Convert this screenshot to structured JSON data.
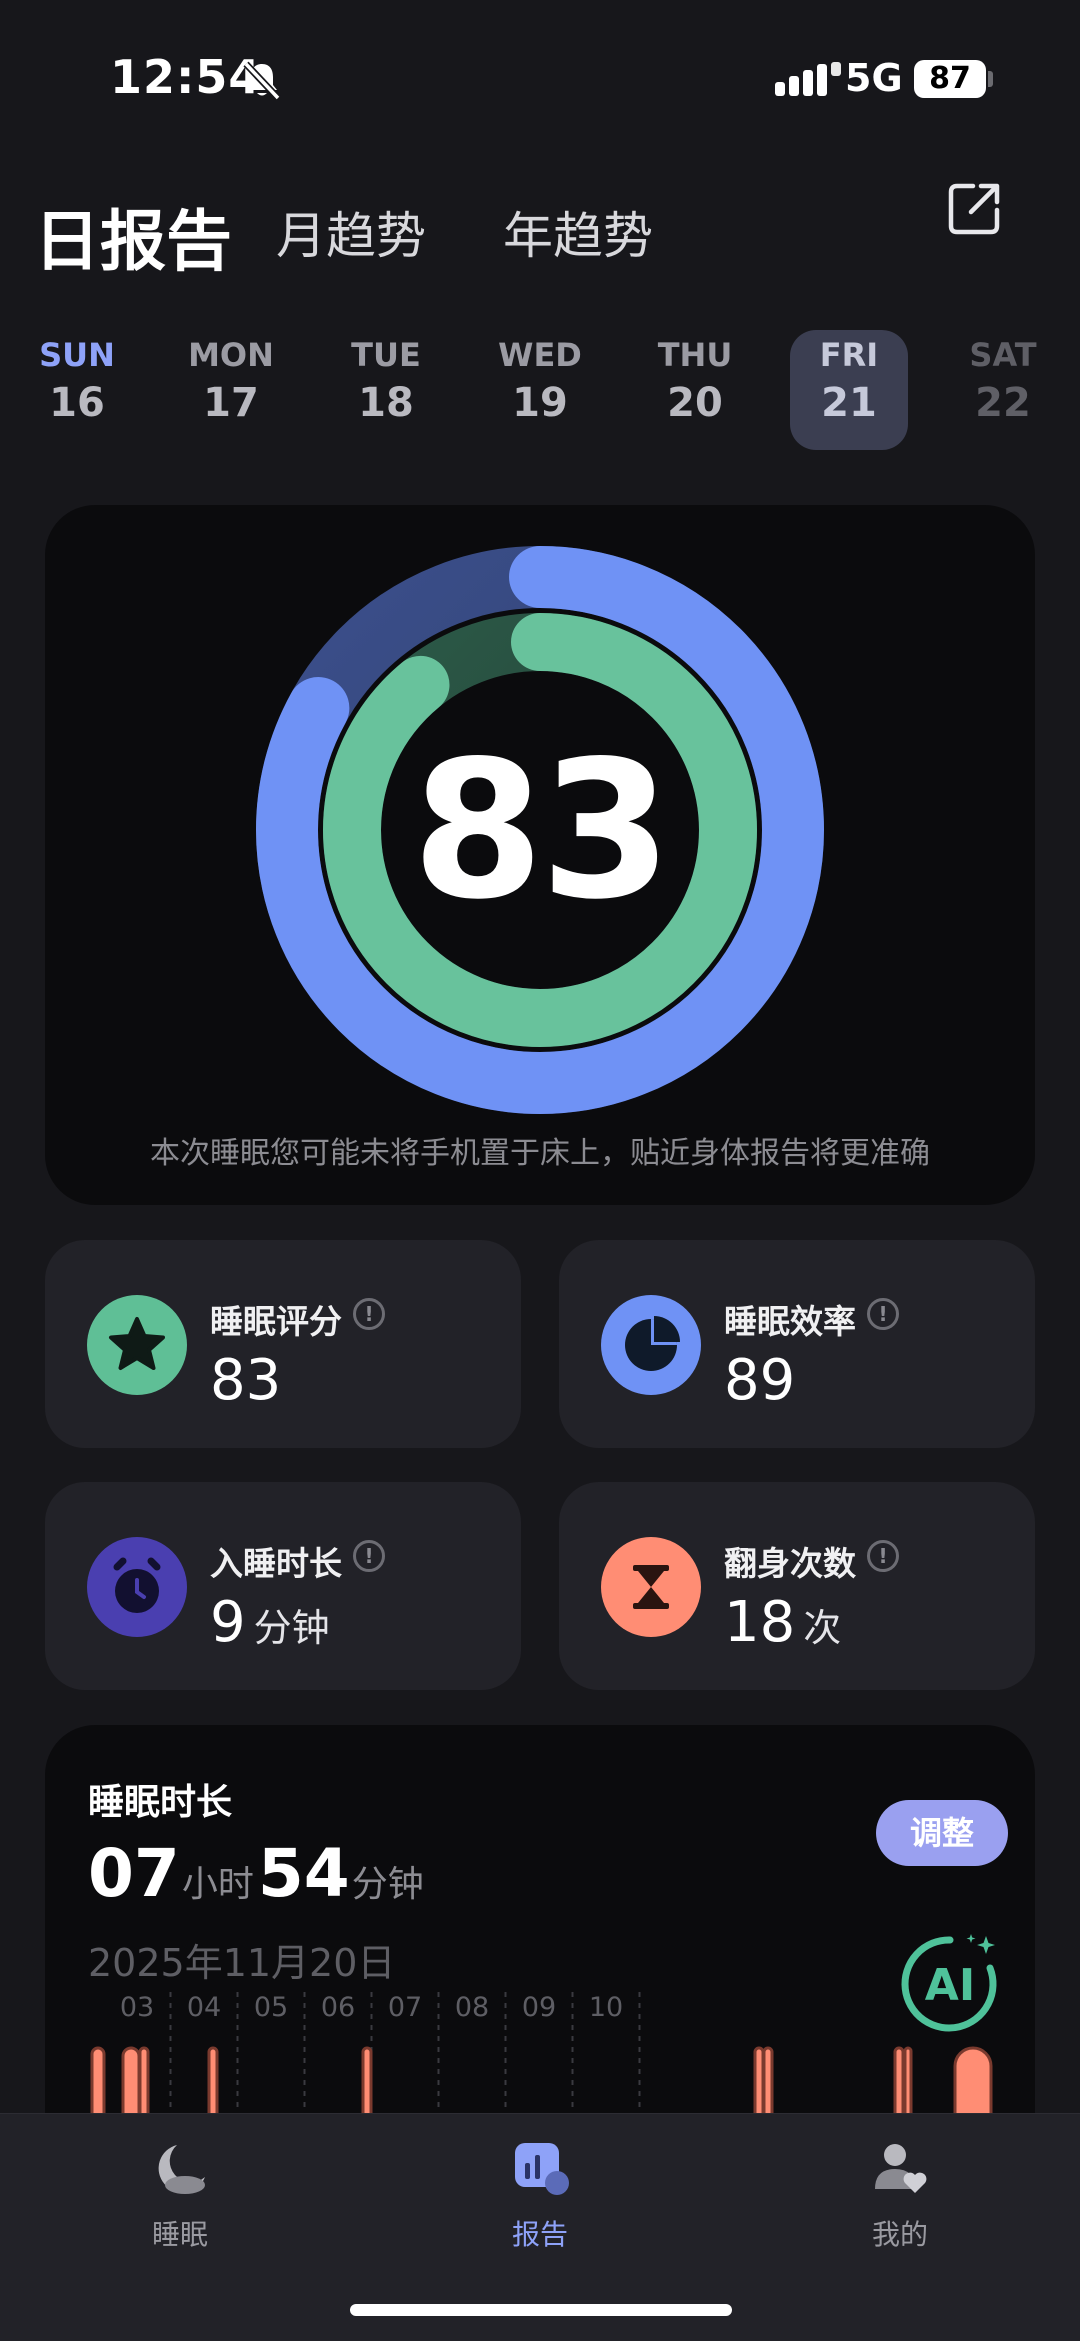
{
  "status": {
    "time": "12:54",
    "network": "5G",
    "battery": "87"
  },
  "header": {
    "tabs": [
      "日报告",
      "月趋势",
      "年趋势"
    ]
  },
  "week": [
    {
      "wd": "SUN",
      "dn": "16"
    },
    {
      "wd": "MON",
      "dn": "17"
    },
    {
      "wd": "TUE",
      "dn": "18"
    },
    {
      "wd": "WED",
      "dn": "19"
    },
    {
      "wd": "THU",
      "dn": "20"
    },
    {
      "wd": "FRI",
      "dn": "21"
    },
    {
      "wd": "SAT",
      "dn": "22"
    }
  ],
  "score": {
    "value": "83",
    "outer_ring_fraction": 0.83,
    "inner_ring_fraction": 0.89,
    "hint": "本次睡眠您可能未将手机置于床上，贴近身体报告将更准确"
  },
  "stats": [
    {
      "label": "睡眠评分",
      "value": "83",
      "unit": "",
      "icon": "star-icon",
      "color": "#5fbf96"
    },
    {
      "label": "睡眠效率",
      "value": "89",
      "unit": "",
      "icon": "pie-chart-icon",
      "color": "#6f92f5"
    },
    {
      "label": "入睡时长",
      "value": "9",
      "unit": "分钟",
      "icon": "alarm-clock-icon",
      "color": "#4a3fb0"
    },
    {
      "label": "翻身次数",
      "value": "18",
      "unit": "次",
      "icon": "hourglass-icon",
      "color": "#ff8d74"
    }
  ],
  "duration": {
    "title": "睡眠时长",
    "hours": "07",
    "hours_unit": "小时",
    "minutes": "54",
    "minutes_unit": "分钟",
    "date": "2025年11月20日",
    "adjust_label": "调整",
    "ai_label": "AI",
    "hours_axis": [
      "03",
      "04",
      "05",
      "06",
      "07",
      "08",
      "09",
      "10"
    ]
  },
  "nav": [
    {
      "label": "睡眠",
      "icon": "moon-icon"
    },
    {
      "label": "报告",
      "icon": "report-icon"
    },
    {
      "label": "我的",
      "icon": "profile-icon"
    }
  ],
  "colors": {
    "accent": "#8ea2f8",
    "blue_ring": "#6f92f5",
    "green_ring": "#68c29c",
    "salmon": "#ff8d74"
  }
}
